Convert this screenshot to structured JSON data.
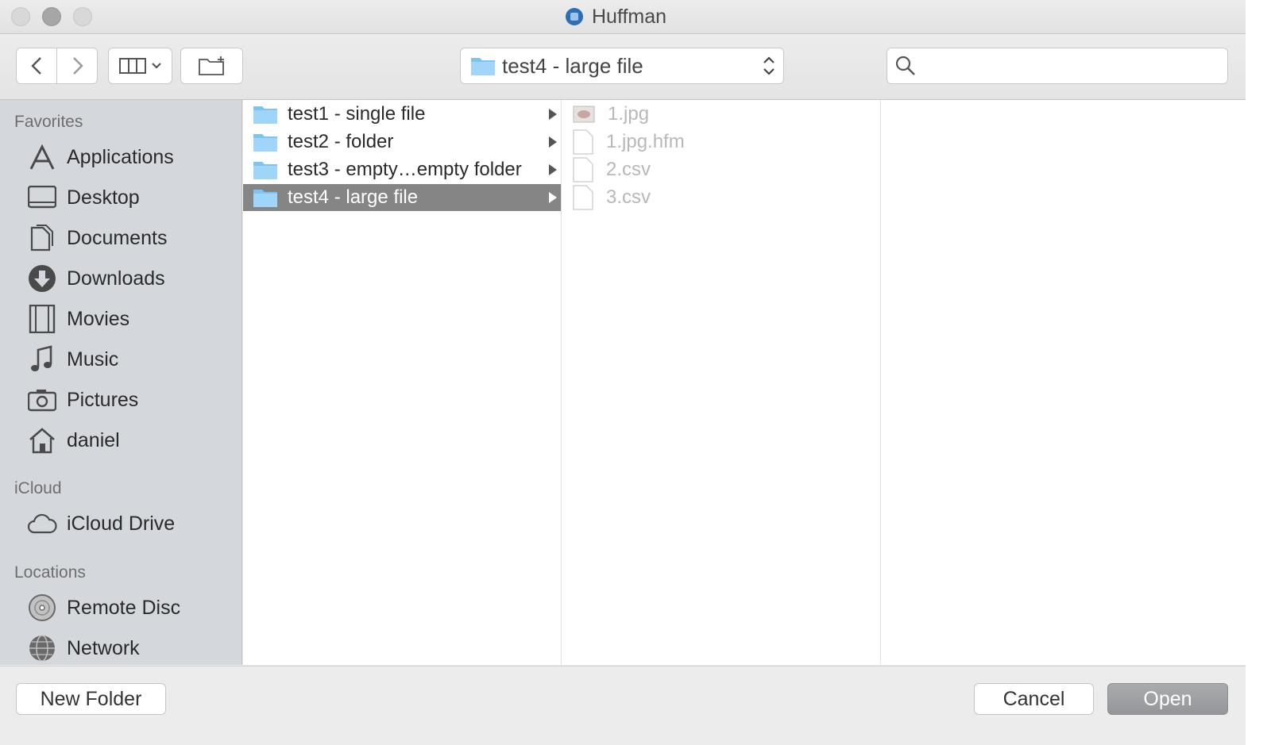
{
  "window": {
    "title": "Huffman"
  },
  "toolbar": {
    "back_icon": "chevron-left-icon",
    "forward_icon": "chevron-right-icon",
    "view_icon": "column-view-icon",
    "new_folder_icon": "new-folder-icon",
    "path_label": "test4 - large file",
    "search_placeholder": ""
  },
  "sidebar": {
    "favorites_label": "Favorites",
    "favorites": [
      {
        "label": "Applications",
        "icon": "applications-icon"
      },
      {
        "label": "Desktop",
        "icon": "desktop-icon"
      },
      {
        "label": "Documents",
        "icon": "documents-icon"
      },
      {
        "label": "Downloads",
        "icon": "downloads-icon"
      },
      {
        "label": "Movies",
        "icon": "movies-icon"
      },
      {
        "label": "Music",
        "icon": "music-icon"
      },
      {
        "label": "Pictures",
        "icon": "pictures-icon"
      },
      {
        "label": "daniel",
        "icon": "home-icon"
      }
    ],
    "icloud_label": "iCloud",
    "icloud": [
      {
        "label": "iCloud Drive",
        "icon": "cloud-icon"
      }
    ],
    "locations_label": "Locations",
    "locations": [
      {
        "label": "Remote Disc",
        "icon": "disc-icon"
      },
      {
        "label": "Network",
        "icon": "network-icon"
      }
    ]
  },
  "columns": {
    "col1": [
      {
        "label": "test1 - single file",
        "selected": false
      },
      {
        "label": "test2 - folder",
        "selected": false
      },
      {
        "label": "test3 - empty…empty folder",
        "selected": false
      },
      {
        "label": "test4 - large file",
        "selected": true
      }
    ],
    "col2": [
      {
        "label": "1.jpg",
        "icon": "image-file-icon"
      },
      {
        "label": "1.jpg.hfm",
        "icon": "document-file-icon"
      },
      {
        "label": "2.csv",
        "icon": "document-file-icon"
      },
      {
        "label": "3.csv",
        "icon": "document-file-icon"
      }
    ]
  },
  "footer": {
    "new_folder_label": "New Folder",
    "cancel_label": "Cancel",
    "open_label": "Open"
  },
  "colors": {
    "selection": "#858585",
    "folder_blue": "#7ec4f2",
    "sidebar_bg": "#d4d8dd"
  }
}
